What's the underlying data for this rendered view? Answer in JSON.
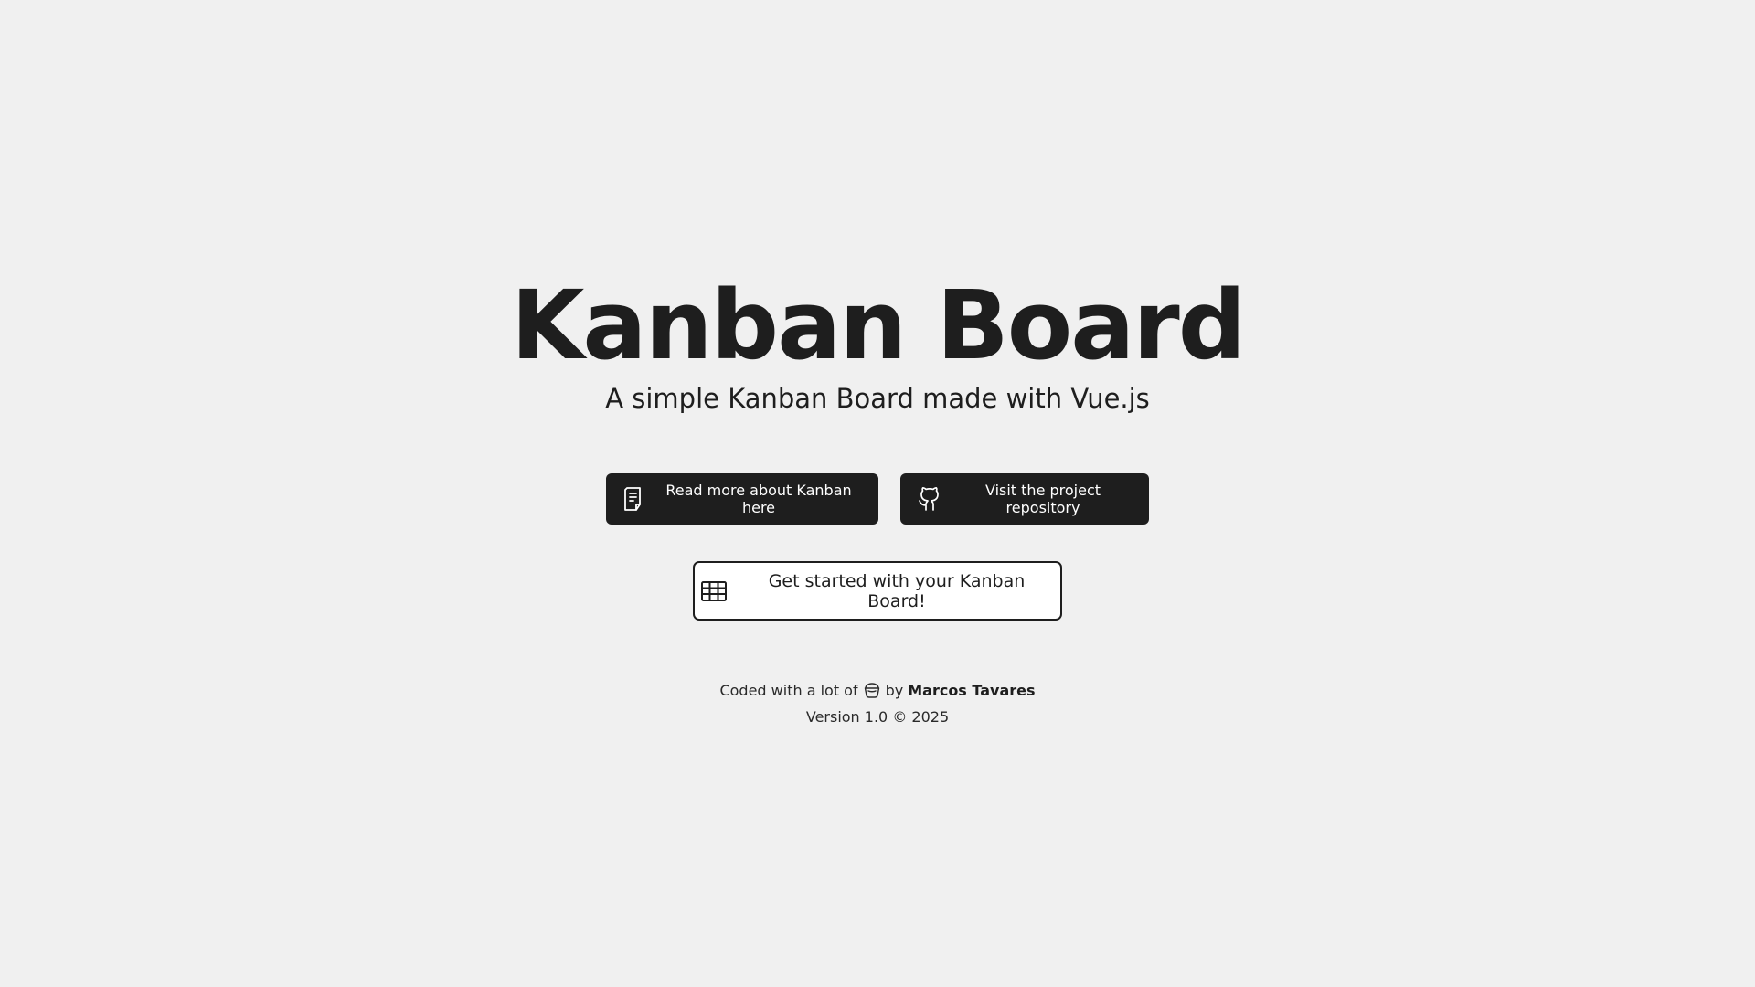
{
  "hero": {
    "title": "Kanban Board",
    "subtitle": "A simple Kanban Board made with Vue.js"
  },
  "actions": {
    "read_more_label": "Read more about Kanban here",
    "read_more_icon": "document-icon",
    "repository_label": "Visit the project repository",
    "repository_icon": "github-icon",
    "get_started_label": "Get started with your Kanban Board!",
    "get_started_icon": "table-icon"
  },
  "footer": {
    "coded_prefix": "Coded with a lot of",
    "coded_icon": "coffee-icon",
    "by_text": "by",
    "author": "Marcos Tavares",
    "version": "Version 1.0 © 2025"
  },
  "colors": {
    "background": "#f0f0f0",
    "text": "#1e1e1e",
    "button_dark": "#1e1e1e",
    "button_outline_bg": "#ffffff"
  }
}
